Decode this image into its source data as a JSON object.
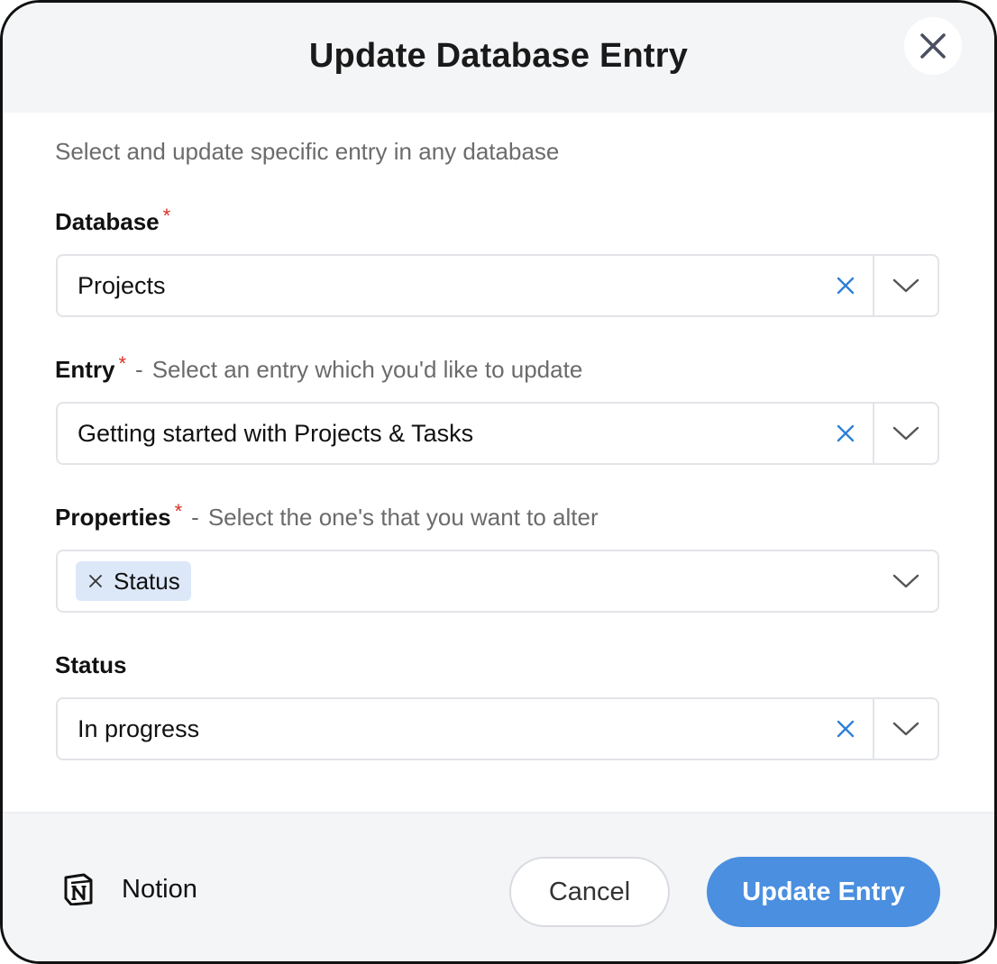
{
  "dialog": {
    "title": "Update Database Entry",
    "subtitle": "Select and update specific entry in any database"
  },
  "fields": {
    "database": {
      "label": "Database",
      "required_mark": "*",
      "value": "Projects"
    },
    "entry": {
      "label": "Entry",
      "required_mark": "*",
      "hint": "Select an entry which you'd like to update",
      "value": "Getting started with Projects & Tasks"
    },
    "properties": {
      "label": "Properties",
      "required_mark": "*",
      "hint": "Select the one's that you want to alter",
      "chips": [
        "Status"
      ]
    },
    "status": {
      "label": "Status",
      "value": "In progress"
    }
  },
  "separator": "-",
  "footer": {
    "app_name": "Notion",
    "cancel_label": "Cancel",
    "submit_label": "Update Entry"
  },
  "icons": {
    "close": "close-icon",
    "clear": "clear-icon",
    "dropdown": "chevron-down-icon",
    "app": "notion-logo-icon"
  },
  "colors": {
    "required": "#d93025",
    "accent": "#4a8fe0",
    "clear_icon": "#2f7fd6",
    "chip_bg": "#dce8f8",
    "header_bg": "#f4f5f7"
  }
}
